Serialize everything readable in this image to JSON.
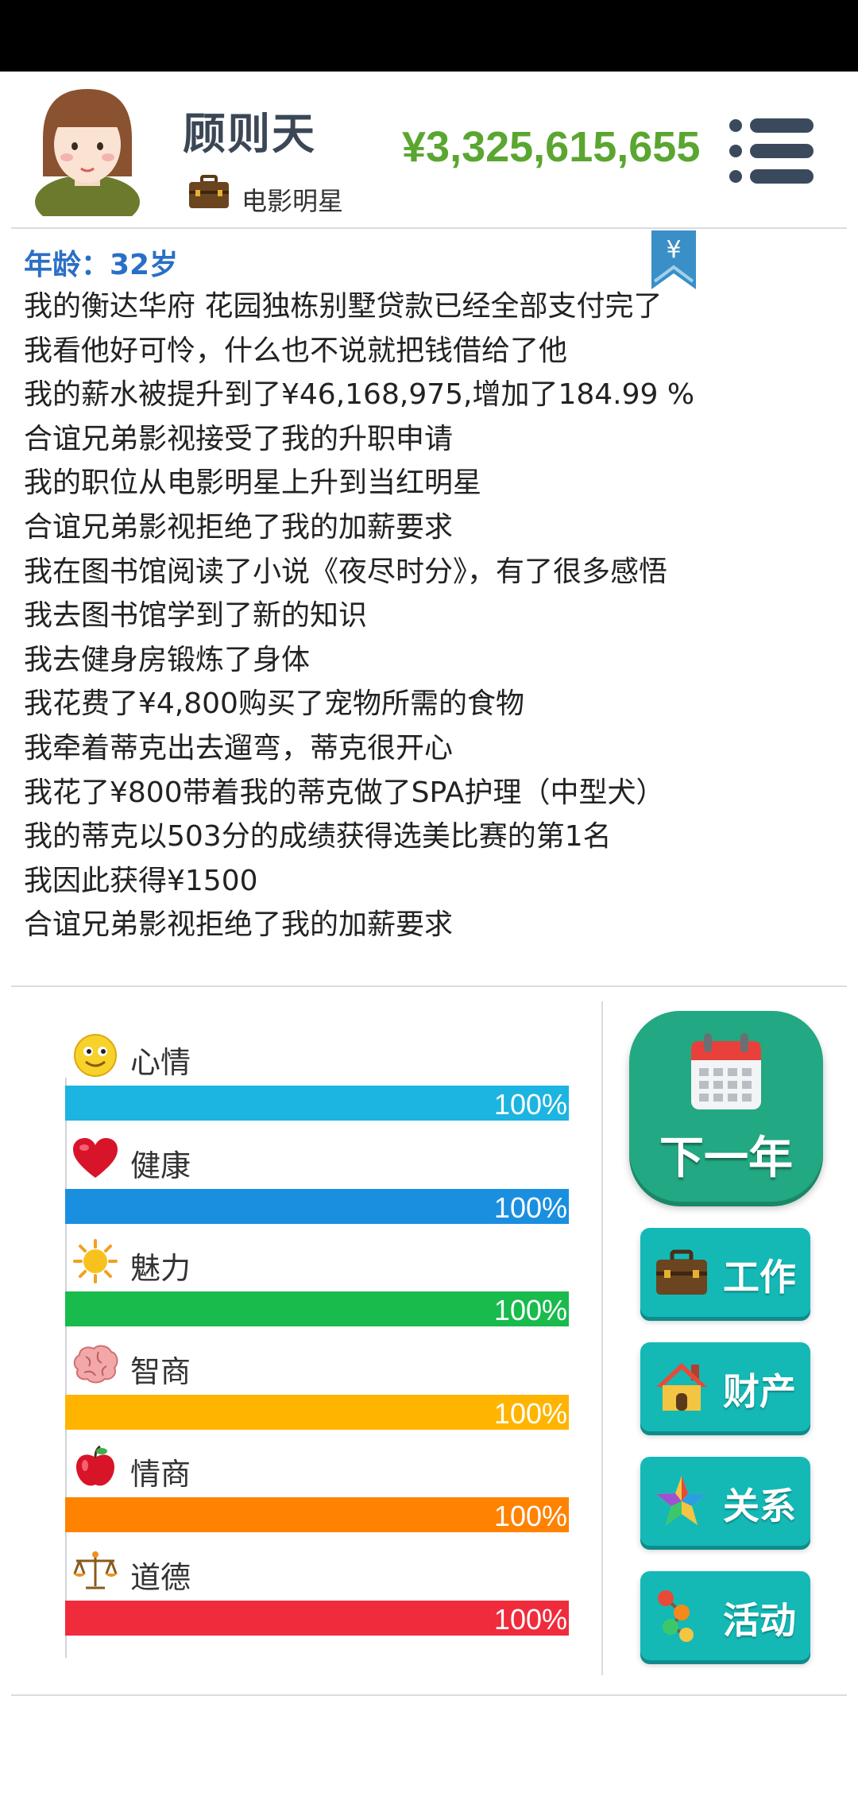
{
  "colors": {
    "money": "#5aa630",
    "age": "#2a6fc6",
    "next_year_button": "#22a882",
    "action_button": "#14b9b6"
  },
  "header": {
    "name": "顾则天",
    "job_title": "电影明星",
    "money": "¥3,325,615,655",
    "avatar_icon": "avatar-girl",
    "job_icon": "briefcase-icon",
    "menu_icon": "menu-icon"
  },
  "log": {
    "bookmark_symbol": "¥",
    "age": "年龄：32岁",
    "entries": [
      "我的衡达华府 花园独栋别墅贷款已经全部支付完了",
      "我看他好可怜，什么也不说就把钱借给了他",
      "我的薪水被提升到了¥46,168,975,增加了184.99 %",
      "合谊兄弟影视接受了我的升职申请",
      "我的职位从电影明星上升到当红明星",
      "合谊兄弟影视拒绝了我的加薪要求",
      "我在图书馆阅读了小说《夜尽时分》，有了很多感悟",
      "我去图书馆学到了新的知识",
      "我去健身房锻炼了身体",
      "我花费了¥4,800购买了宠物所需的食物",
      "我牵着蒂克出去遛弯，蒂克很开心",
      "我花了¥800带着我的蒂克做了SPA护理（中型犬）",
      "我的蒂克以503分的成绩获得选美比赛的第1名",
      "我因此获得¥1500",
      "合谊兄弟影视拒绝了我的加薪要求"
    ]
  },
  "stats": [
    {
      "label": "心情",
      "pct_text": "100%",
      "value": 1.0,
      "color": "#1cb4e0",
      "icon": "smiley-icon"
    },
    {
      "label": "健康",
      "pct_text": "100%",
      "value": 1.0,
      "color": "#1a8fe0",
      "icon": "heart-icon"
    },
    {
      "label": "魅力",
      "pct_text": "100%",
      "value": 1.0,
      "color": "#18bb4c",
      "icon": "sun-icon"
    },
    {
      "label": "智商",
      "pct_text": "100%",
      "value": 1.0,
      "color": "#ffb400",
      "icon": "brain-icon"
    },
    {
      "label": "情商",
      "pct_text": "100%",
      "value": 1.0,
      "color": "#ff8200",
      "icon": "apple-icon"
    },
    {
      "label": "道德",
      "pct_text": "100%",
      "value": 1.0,
      "color": "#ef2b3c",
      "icon": "scales-icon"
    }
  ],
  "actions": {
    "next_year": "下一年",
    "next_year_icon": "calendar-icon",
    "buttons": [
      {
        "label": "工作",
        "icon": "briefcase-icon"
      },
      {
        "label": "财产",
        "icon": "house-icon"
      },
      {
        "label": "关系",
        "icon": "star-icon"
      },
      {
        "label": "活动",
        "icon": "activity-icon"
      }
    ]
  }
}
